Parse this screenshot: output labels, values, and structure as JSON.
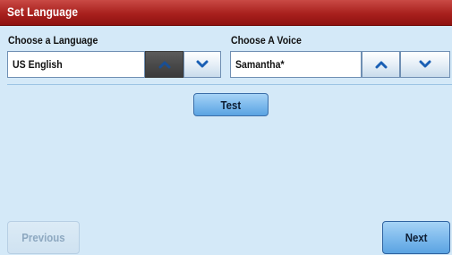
{
  "window": {
    "title": "Set Language"
  },
  "language": {
    "label": "Choose a Language",
    "value": "US English",
    "up_icon": "chevron-up-icon",
    "down_icon": "chevron-down-icon",
    "up_pressed": true
  },
  "voice": {
    "label": "Choose A Voice",
    "value": "Samantha*",
    "up_icon": "chevron-up-icon",
    "down_icon": "chevron-down-icon"
  },
  "buttons": {
    "test": "Test",
    "previous": "Previous",
    "previous_enabled": false,
    "next": "Next"
  },
  "colors": {
    "title_bar": "#a8201d",
    "background": "#d4e9f8",
    "button_blue": "#7fbbed",
    "pressed_button": "#4a4a4a",
    "arrow_blue": "#1a5fb4"
  }
}
